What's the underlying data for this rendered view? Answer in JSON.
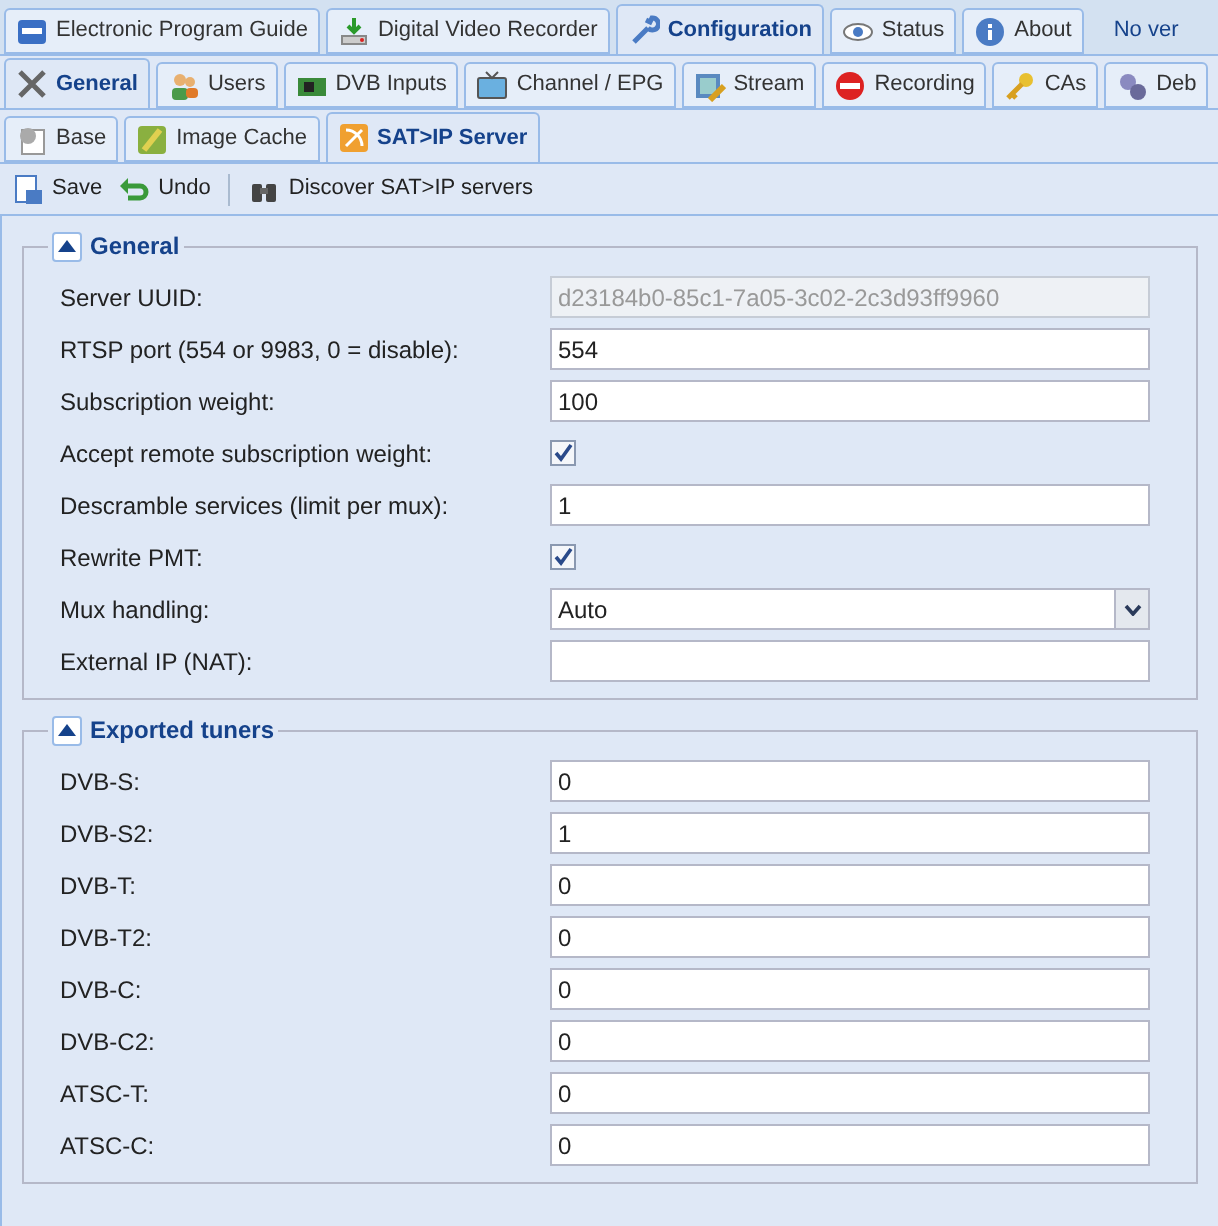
{
  "main_tabs": [
    {
      "label": "Electronic Program Guide",
      "selected": false
    },
    {
      "label": "Digital Video Recorder",
      "selected": false
    },
    {
      "label": "Configuration",
      "selected": true
    },
    {
      "label": "Status",
      "selected": false
    },
    {
      "label": "About",
      "selected": false
    }
  ],
  "version_text": "No ver",
  "config_tabs": [
    {
      "label": "General",
      "selected": true
    },
    {
      "label": "Users",
      "selected": false
    },
    {
      "label": "DVB Inputs",
      "selected": false
    },
    {
      "label": "Channel / EPG",
      "selected": false
    },
    {
      "label": "Stream",
      "selected": false
    },
    {
      "label": "Recording",
      "selected": false
    },
    {
      "label": "CAs",
      "selected": false
    },
    {
      "label": "Deb",
      "selected": false
    }
  ],
  "general_tabs": [
    {
      "label": "Base",
      "selected": false
    },
    {
      "label": "Image Cache",
      "selected": false
    },
    {
      "label": "SAT>IP Server",
      "selected": true
    }
  ],
  "toolbar": [
    {
      "label": "Save"
    },
    {
      "label": "Undo"
    },
    {
      "label": "Discover SAT>IP servers"
    }
  ],
  "sections": [
    {
      "title": "General",
      "expanded": true,
      "fields": [
        {
          "label": "Server UUID:",
          "kind": "text",
          "value": "d23184b0-85c1-7a05-3c02-2c3d93ff9960",
          "disabled": true
        },
        {
          "label": "RTSP port (554 or 9983, 0 = disable):",
          "kind": "text",
          "value": "554",
          "disabled": false
        },
        {
          "label": "Subscription weight:",
          "kind": "text",
          "value": "100",
          "disabled": false
        },
        {
          "label": "Accept remote subscription weight:",
          "kind": "checkbox",
          "checked": true
        },
        {
          "label": "Descramble services (limit per mux):",
          "kind": "text",
          "value": "1",
          "disabled": false
        },
        {
          "label": "Rewrite PMT:",
          "kind": "checkbox",
          "checked": true
        },
        {
          "label": "Mux handling:",
          "kind": "select",
          "value": "Auto"
        },
        {
          "label": "External IP (NAT):",
          "kind": "text",
          "disabled": false
        }
      ]
    },
    {
      "title": "Exported tuners",
      "expanded": true,
      "fields": [
        {
          "label": "DVB-S:",
          "kind": "text",
          "value": "0",
          "disabled": false
        },
        {
          "label": "DVB-S2:",
          "kind": "text",
          "value": "1",
          "disabled": false
        },
        {
          "label": "DVB-T:",
          "kind": "text",
          "value": "0",
          "disabled": false
        },
        {
          "label": "DVB-T2:",
          "kind": "text",
          "value": "0",
          "disabled": false
        },
        {
          "label": "DVB-C:",
          "kind": "text",
          "value": "0",
          "disabled": false
        },
        {
          "label": "DVB-C2:",
          "kind": "text",
          "value": "0",
          "disabled": false
        },
        {
          "label": "ATSC-T:",
          "kind": "text",
          "value": "0",
          "disabled": false
        },
        {
          "label": "ATSC-C:",
          "kind": "text",
          "value": "0",
          "disabled": false
        }
      ]
    }
  ]
}
